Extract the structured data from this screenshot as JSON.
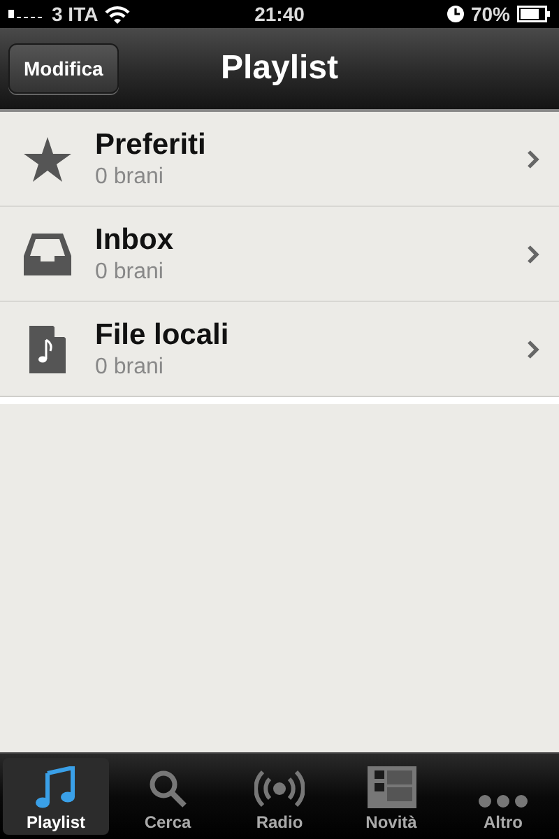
{
  "status_bar": {
    "carrier": "3 ITA",
    "time": "21:40",
    "battery": "70%"
  },
  "nav_bar": {
    "edit_button": "Modifica",
    "title": "Playlist"
  },
  "playlists": [
    {
      "kind": "star",
      "name": "Preferiti",
      "count": "0 brani"
    },
    {
      "kind": "inbox",
      "name": "Inbox",
      "count": "0 brani"
    },
    {
      "kind": "file",
      "name": "File locali",
      "count": "0 brani"
    }
  ],
  "tab_bar": [
    {
      "kind": "music",
      "label": "Playlist",
      "selected": true
    },
    {
      "kind": "search",
      "label": "Cerca",
      "selected": false
    },
    {
      "kind": "radio",
      "label": "Radio",
      "selected": false
    },
    {
      "kind": "news",
      "label": "Novità",
      "selected": false
    },
    {
      "kind": "more",
      "label": "Altro",
      "selected": false
    }
  ]
}
